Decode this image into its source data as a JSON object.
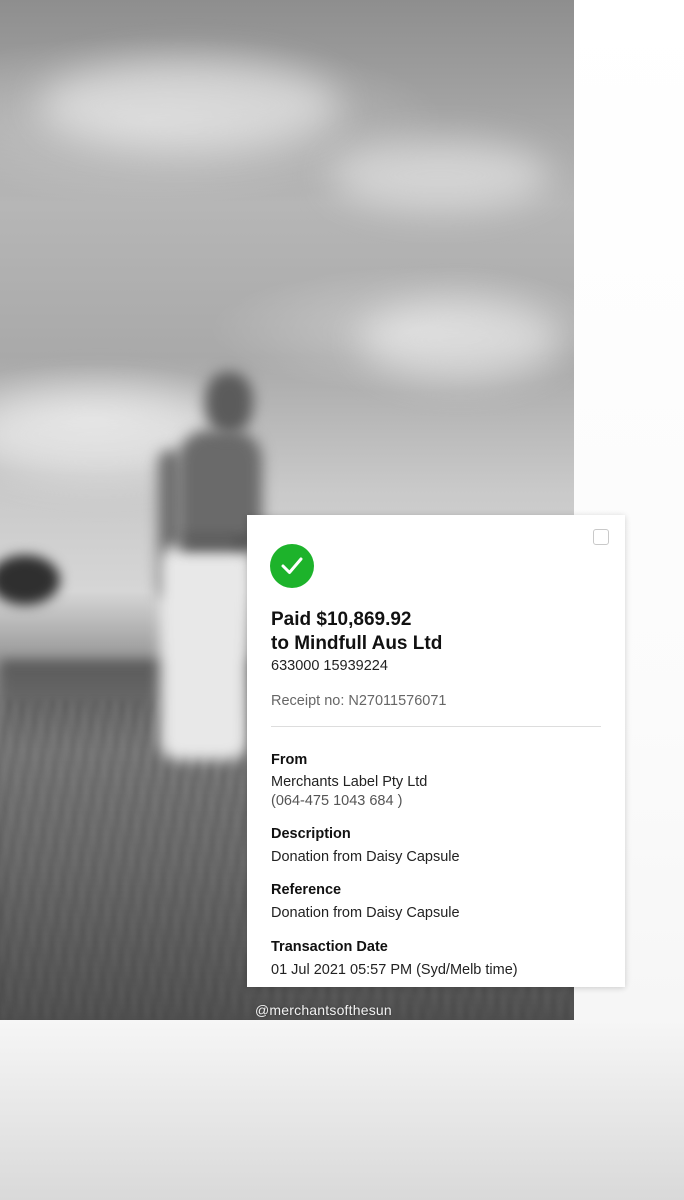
{
  "photo": {
    "handle": "@merchantsofthesun"
  },
  "receipt": {
    "status_icon": "checkmark-icon",
    "status_color": "#1db32b",
    "title_line1": "Paid $10,869.92",
    "title_line2": "to Mindfull Aus Ltd",
    "account": "633000 15939224",
    "receipt_no": "Receipt no: N27011576071",
    "from_label": "From",
    "from_value": "Merchants Label Pty Ltd",
    "from_account": "(064-475 1043 684  )",
    "description_label": "Description",
    "description_value": "Donation from Daisy Capsule",
    "reference_label": "Reference",
    "reference_value": "Donation from Daisy Capsule",
    "date_label": "Transaction Date",
    "date_value": "01 Jul 2021 05:57 PM (Syd/Melb time)"
  }
}
